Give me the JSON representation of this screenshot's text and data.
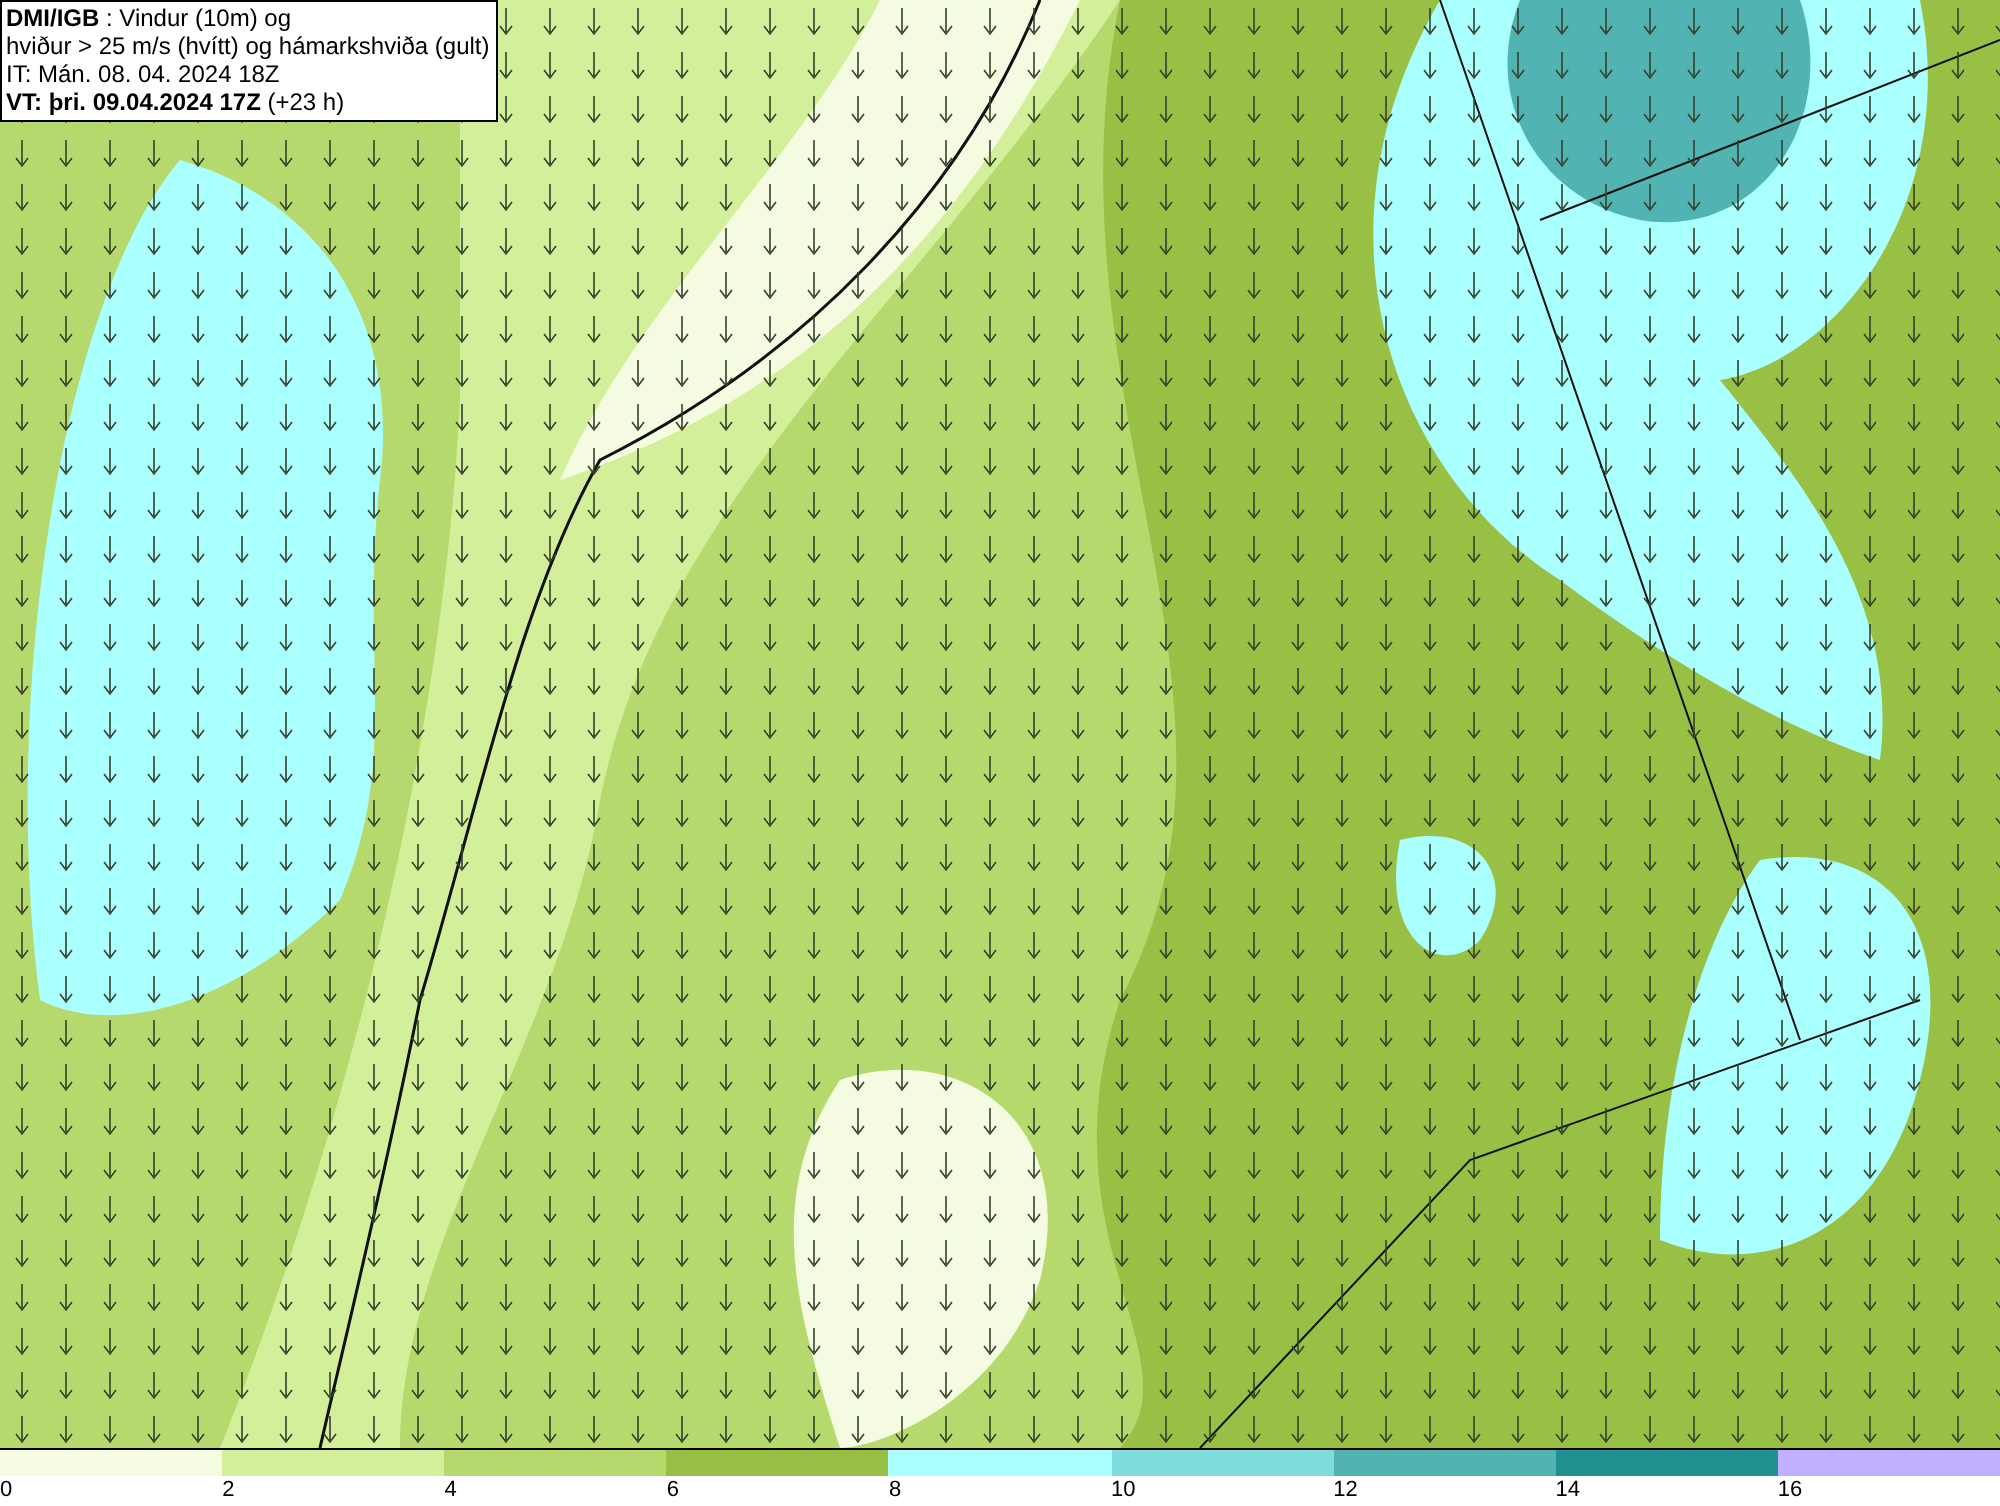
{
  "info_box": {
    "lines": [
      "**DMI/IGB** : Vindur (10m) og",
      "hviður > 25 m/s (hvítt) og hámarkshviða (gult)",
      "IT: Mán. 08. 04. 2024 18Z",
      "**VT: þri. 09.04.2024 17Z** (+23 h)"
    ]
  },
  "legend": [
    {
      "label": "0",
      "color": "#f4fbe0"
    },
    {
      "label": "2",
      "color": "#d4ef9a"
    },
    {
      "label": "4",
      "color": "#b5d96c"
    },
    {
      "label": "6",
      "color": "#97c045"
    },
    {
      "label": "8",
      "color": "#aaffff"
    },
    {
      "label": "10",
      "color": "#7fdcdc"
    },
    {
      "label": "12",
      "color": "#52b3b3"
    },
    {
      "label": "14",
      "color": "#208f8f"
    },
    {
      "label": "16",
      "color": "#c0b0ff"
    }
  ]
}
